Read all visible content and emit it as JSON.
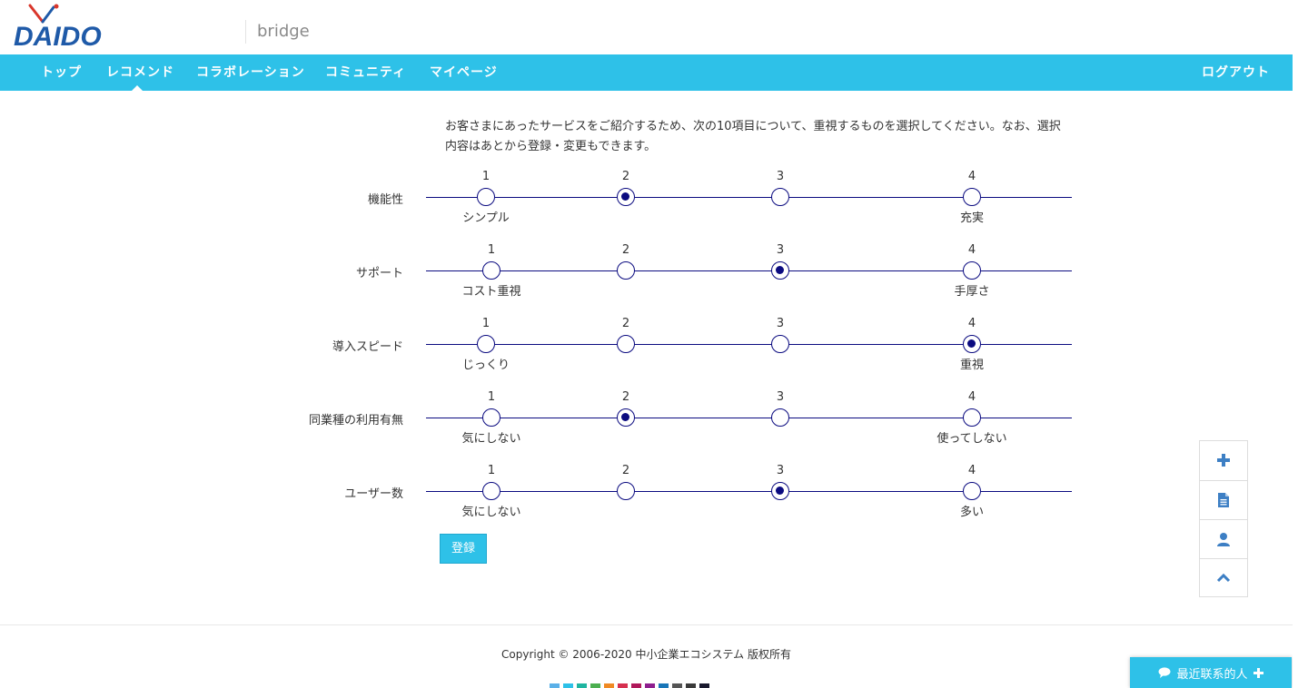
{
  "header": {
    "logo_text": "DAIDO",
    "site_name": "bridge"
  },
  "nav": {
    "items": [
      {
        "label": "トップ"
      },
      {
        "label": "レコメンド"
      },
      {
        "label": "コラボレーション"
      },
      {
        "label": "コミュニティ"
      },
      {
        "label": "マイページ"
      }
    ],
    "active": "レコメンド",
    "logout_label": "ログアウト"
  },
  "intro_text": "お客さまにあったサービスをご紹介するため、次の10項目について、重視するものを選択してください。なお、選択内容はあとから登録・変更もできます。",
  "rows": [
    {
      "label": "機能性",
      "left_caption": "シンプル",
      "right_caption": "充実",
      "selected": 2
    },
    {
      "label": "サポート",
      "left_caption": "コスト重視",
      "right_caption": "手厚さ",
      "selected": 3
    },
    {
      "label": "導入スピード",
      "left_caption": "じっくり",
      "right_caption": "重視",
      "selected": 4
    },
    {
      "label": "同業種の利用有無",
      "left_caption": "気にしない",
      "right_caption": "使ってしない",
      "selected": 2
    },
    {
      "label": "ユーザー数",
      "left_caption": "気にしない",
      "right_caption": "多い",
      "selected": 3
    }
  ],
  "scale_numbers": [
    "1",
    "2",
    "3",
    "4"
  ],
  "submit_label": "登録",
  "float_panel": {
    "icons": [
      "plus-icon",
      "document-icon",
      "user-icon",
      "chevron-up-icon"
    ]
  },
  "footer": {
    "copyright": "Copyright © 2006-2020 中小企業エコシステム 版权所有",
    "swatch_colors": [
      "#5bb0e8",
      "#2ec1e8",
      "#1fb5a0",
      "#4caf50",
      "#f08a24",
      "#d6304f",
      "#b0185a",
      "#8e1e8e",
      "#1976b8",
      "#555555",
      "#3a3a3a",
      "#1a1a2e"
    ]
  },
  "chat": {
    "label": "最近联系的人"
  },
  "colors": {
    "accent": "#2ec1e8",
    "scale_line": "#0b0b80"
  }
}
